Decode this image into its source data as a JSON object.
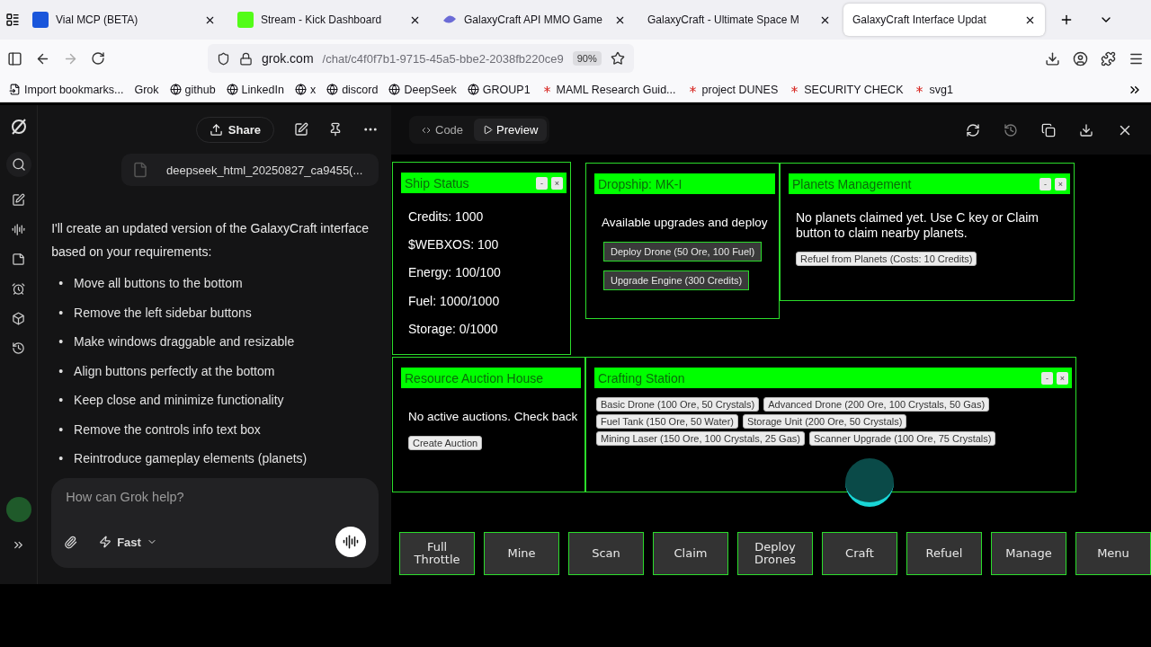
{
  "browser": {
    "tabs": [
      {
        "title": "Vial MCP (BETA)",
        "selected": false,
        "kind": "blue"
      },
      {
        "title": "Stream - Kick Dashboard",
        "selected": false,
        "kind": "green"
      },
      {
        "title": "GalaxyCraft API MMO Game",
        "selected": false,
        "kind": "galaxy"
      },
      {
        "title": "GalaxyCraft - Ultimate Space M",
        "selected": false,
        "kind": "none"
      },
      {
        "title": "GalaxyCraft Interface Updat",
        "selected": true,
        "kind": "none"
      }
    ],
    "url_host": "grok.com",
    "url_path": "/chat/c4f0f7b1-9715-45a5-bbe2-2038fb220ce9",
    "zoom": "90%",
    "bookmarks": [
      {
        "label": "Import bookmarks...",
        "kind": "import"
      },
      {
        "label": "Grok",
        "kind": "plain"
      },
      {
        "label": "github",
        "kind": "site"
      },
      {
        "label": "LinkedIn",
        "kind": "site"
      },
      {
        "label": "x",
        "kind": "site"
      },
      {
        "label": "discord",
        "kind": "site"
      },
      {
        "label": "DeepSeek",
        "kind": "site"
      },
      {
        "label": "GROUP1",
        "kind": "site"
      },
      {
        "label": "MAML Research Guid...",
        "kind": "spark"
      },
      {
        "label": "project DUNES",
        "kind": "spark"
      },
      {
        "label": "SECURITY CHECK",
        "kind": "spark"
      },
      {
        "label": "svg1",
        "kind": "spark"
      }
    ]
  },
  "chat": {
    "share": "Share",
    "attachment": "deepseek_html_20250827_ca9455(...",
    "intro": "I'll create an updated version of the GalaxyCraft interface based on your requirements:",
    "marker": "•",
    "bullets": [
      "Move all buttons to the bottom",
      "Remove the left sidebar buttons",
      "Make windows draggable and resizable",
      "Align buttons perfectly at the bottom",
      "Keep close and minimize functionality",
      "Remove the controls info text box",
      "Reintroduce gameplay elements (planets)"
    ],
    "input": {
      "placeholder": "How can Grok help?"
    },
    "mode": "Fast"
  },
  "preview": {
    "tabs": [
      {
        "label": "Code",
        "selected": false
      },
      {
        "label": "Preview",
        "selected": true
      }
    ],
    "windows": [
      {
        "title": "Ship Status",
        "kind": "stats",
        "controls": [
          "-",
          "×"
        ],
        "lines": [
          "Credits: 1000",
          "$WEBXOS: 100",
          "Energy: 100/100",
          "Fuel: 1000/1000",
          "Storage: 0/1000"
        ]
      },
      {
        "title": "Dropship: MK-I",
        "kind": "upgrades",
        "text": "Available upgrades and deploy",
        "buttons": [
          "Deploy Drone (50 Ore, 100 Fuel)",
          "Upgrade Engine (300 Credits)"
        ]
      },
      {
        "title": "Planets Management",
        "kind": "planets",
        "controls": [
          "-",
          "×"
        ],
        "text": "No planets claimed yet. Use C key or Claim button to claim nearby planets.",
        "buttons": [
          "Refuel from Planets (Costs: 10 Credits)"
        ]
      },
      {
        "title": "Resource Auction House",
        "kind": "auction",
        "text": "No active auctions. Check back",
        "buttons": [
          "Create Auction"
        ]
      },
      {
        "title": "Crafting Station",
        "kind": "crafting",
        "controls": [
          "-",
          "×"
        ],
        "buttons": [
          "Basic Drone (100 Ore, 50 Crystals)",
          "Advanced Drone (200 Ore, 100 Crystals, 50 Gas)",
          "Fuel Tank (150 Ore, 50 Water)",
          "Storage Unit (200 Ore, 50 Crystals)",
          "Mining Laser (150 Ore, 100 Crystals, 25 Gas)",
          "Scanner Upgrade (100 Ore, 75 Crystals)"
        ]
      }
    ],
    "actions": [
      "Full Throttle",
      "Mine",
      "Scan",
      "Claim",
      "Deploy Drones",
      "Craft",
      "Refuel",
      "Manage",
      "Menu"
    ]
  }
}
